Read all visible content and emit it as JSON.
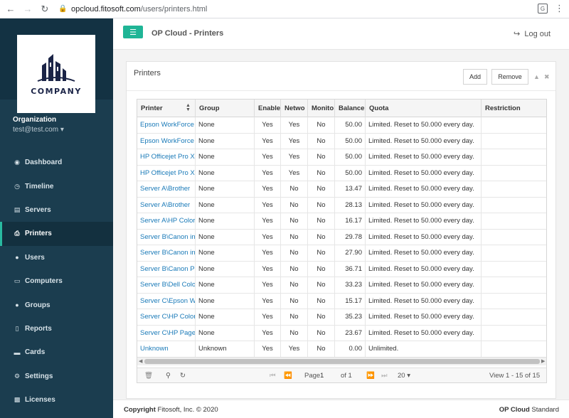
{
  "browser": {
    "url_host": "opcloud.fitosoft.com",
    "url_path": "/users/printers.html"
  },
  "sidebar": {
    "logo_text": "COMPANY",
    "org_name": "Organization",
    "org_email": "test@test.com",
    "items": [
      {
        "label": "Dashboard",
        "icon": "dashboard-icon"
      },
      {
        "label": "Timeline",
        "icon": "clock-icon"
      },
      {
        "label": "Servers",
        "icon": "server-icon"
      },
      {
        "label": "Printers",
        "icon": "printer-icon"
      },
      {
        "label": "Users",
        "icon": "user-icon"
      },
      {
        "label": "Computers",
        "icon": "laptop-icon"
      },
      {
        "label": "Groups",
        "icon": "users-icon"
      },
      {
        "label": "Reports",
        "icon": "chart-icon"
      },
      {
        "label": "Cards",
        "icon": "card-icon"
      },
      {
        "label": "Settings",
        "icon": "wrench-icon"
      },
      {
        "label": "Licenses",
        "icon": "license-icon"
      }
    ]
  },
  "header": {
    "title": "OP Cloud - Printers",
    "logout": "Log out"
  },
  "panel": {
    "title": "Printers",
    "add": "Add",
    "remove": "Remove"
  },
  "table": {
    "columns": [
      "Printer",
      "Group",
      "Enable",
      "Netwo",
      "Monito",
      "Balance",
      "Quota",
      "Restriction"
    ],
    "rows": [
      [
        "Epson WorkForce",
        "None",
        "Yes",
        "Yes",
        "No",
        "50.00",
        "Limited. Reset to 50.000 every day.",
        ""
      ],
      [
        "Epson WorkForce",
        "None",
        "Yes",
        "Yes",
        "No",
        "50.00",
        "Limited. Reset to 50.000 every day.",
        ""
      ],
      [
        "HP Officejet Pro X",
        "None",
        "Yes",
        "Yes",
        "No",
        "50.00",
        "Limited. Reset to 50.000 every day.",
        ""
      ],
      [
        "HP Officejet Pro X",
        "None",
        "Yes",
        "Yes",
        "No",
        "50.00",
        "Limited. Reset to 50.000 every day.",
        ""
      ],
      [
        "Server A\\Brother",
        "None",
        "Yes",
        "No",
        "No",
        "13.47",
        "Limited. Reset to 50.000 every day.",
        ""
      ],
      [
        "Server A\\Brother",
        "None",
        "Yes",
        "No",
        "No",
        "28.13",
        "Limited. Reset to 50.000 every day.",
        ""
      ],
      [
        "Server A\\HP Color",
        "None",
        "Yes",
        "No",
        "No",
        "16.17",
        "Limited. Reset to 50.000 every day.",
        ""
      ],
      [
        "Server B\\Canon in",
        "None",
        "Yes",
        "No",
        "No",
        "29.78",
        "Limited. Reset to 50.000 every day.",
        ""
      ],
      [
        "Server B\\Canon in",
        "None",
        "Yes",
        "No",
        "No",
        "27.90",
        "Limited. Reset to 50.000 every day.",
        ""
      ],
      [
        "Server B\\Canon P",
        "None",
        "Yes",
        "No",
        "No",
        "36.71",
        "Limited. Reset to 50.000 every day.",
        ""
      ],
      [
        "Server B\\Dell Colo",
        "None",
        "Yes",
        "No",
        "No",
        "33.23",
        "Limited. Reset to 50.000 every day.",
        ""
      ],
      [
        "Server C\\Epson W",
        "None",
        "Yes",
        "No",
        "No",
        "15.17",
        "Limited. Reset to 50.000 every day.",
        ""
      ],
      [
        "Server C\\HP Color",
        "None",
        "Yes",
        "No",
        "No",
        "35.23",
        "Limited. Reset to 50.000 every day.",
        ""
      ],
      [
        "Server C\\HP Page",
        "None",
        "Yes",
        "No",
        "No",
        "23.67",
        "Limited. Reset to 50.000 every day.",
        ""
      ],
      [
        "Unknown",
        "Unknown",
        "Yes",
        "Yes",
        "No",
        "0.00",
        "Unlimited.",
        ""
      ]
    ]
  },
  "pager": {
    "page_label": "Page",
    "page_value": "1",
    "of_label": "of 1",
    "page_size": "20",
    "view_text": "View 1 - 15 of 15"
  },
  "footer": {
    "copyright_bold": "Copyright",
    "copyright_rest": " Fitosoft, Inc. © 2020",
    "product_bold": "OP Cloud",
    "product_rest": " Standard"
  },
  "colors": {
    "sidebar": "#1b3d4f",
    "accent": "#1fb596",
    "link": "#1a7ab8"
  }
}
